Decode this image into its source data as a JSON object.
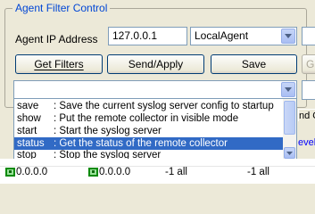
{
  "group": {
    "title": "Agent Filter Control"
  },
  "agent_ip": {
    "label": "Agent IP Address",
    "value": "127.0.0.1"
  },
  "agent_select": {
    "value": "LocalAgent"
  },
  "buttons": {
    "get_filters": "Get Filters",
    "send_apply": "Send/Apply",
    "save": "Save",
    "right_clipped": "G"
  },
  "command_options": [
    {
      "cmd": "save",
      "desc": ": Save the current syslog server config to startup"
    },
    {
      "cmd": "show",
      "desc": ": Put the remote collector in visible mode"
    },
    {
      "cmd": "start",
      "desc": ": Start the syslog server"
    },
    {
      "cmd": "status",
      "desc": ": Get the status of the remote collector"
    },
    {
      "cmd": "stop",
      "desc": ": Stop the syslog server"
    }
  ],
  "selected_option_index": 3,
  "grid": {
    "header_fragment": "nd Ol",
    "level_fragment": "evel",
    "rows": [
      {
        "ip1": "0.0.0.0",
        "ip2": "0.0.0.0",
        "col3": "-1 all",
        "col4": "-1 all"
      }
    ]
  },
  "colors": {
    "group_title": "#0046d5",
    "selection": "#316ac5",
    "link": "#0000ff"
  }
}
